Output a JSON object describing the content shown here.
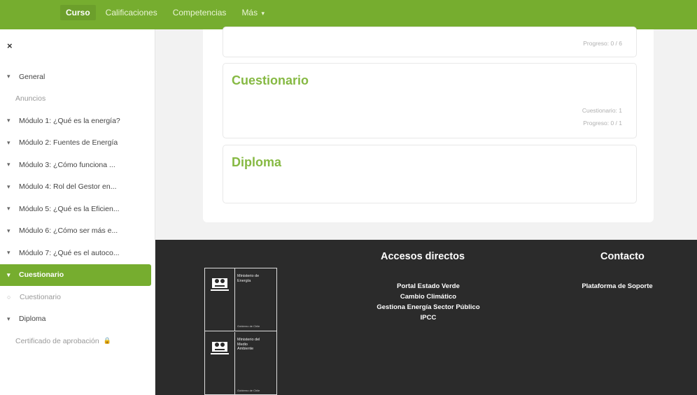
{
  "nav": {
    "items": [
      {
        "label": "Curso",
        "active": true
      },
      {
        "label": "Calificaciones",
        "active": false
      },
      {
        "label": "Competencias",
        "active": false
      },
      {
        "label": "Más",
        "active": false,
        "dropdown": true
      }
    ]
  },
  "drawer": {
    "close_icon": "×",
    "items": [
      {
        "label": "General",
        "kind": "section"
      },
      {
        "label": "Anuncios",
        "kind": "sub"
      },
      {
        "label": "Módulo 1: ¿Qué es la energía?",
        "kind": "section"
      },
      {
        "label": "Módulo 2: Fuentes de Energía",
        "kind": "section"
      },
      {
        "label": "Módulo 3: ¿Cómo funciona ...",
        "kind": "section"
      },
      {
        "label": "Módulo 4: Rol del Gestor en...",
        "kind": "section"
      },
      {
        "label": "Módulo 5: ¿Qué es la Eficien...",
        "kind": "section"
      },
      {
        "label": "Módulo 6: ¿Cómo ser más e...",
        "kind": "section"
      },
      {
        "label": "Módulo 7: ¿Qué es el autoco...",
        "kind": "section"
      },
      {
        "label": "Cuestionario",
        "kind": "section",
        "active": true
      },
      {
        "label": "Cuestionario",
        "kind": "activity"
      },
      {
        "label": "Diploma",
        "kind": "section"
      },
      {
        "label": "Certificado de aprobación",
        "kind": "locked"
      }
    ]
  },
  "sections": {
    "top": {
      "progress": "Progreso: 0 / 6"
    },
    "quiz": {
      "title": "Cuestionario",
      "count": "Cuestionario: 1",
      "progress": "Progreso: 0 / 1"
    },
    "diploma": {
      "title": "Diploma"
    }
  },
  "footer": {
    "logo1": {
      "line1": "Ministerio de",
      "line2": "Energía",
      "foot": "Gobierno de Chile"
    },
    "logo2": {
      "line1": "Ministerio del",
      "line2": "Medio",
      "line3": "Ambiente",
      "foot": "Gobierno de Chile"
    },
    "shortcuts": {
      "title": "Accesos directos",
      "links": [
        "Portal Estado Verde",
        "Cambio Climático",
        "Gestiona Energía Sector Público",
        "IPCC"
      ]
    },
    "contact": {
      "title": "Contacto",
      "links": [
        "Plataforma de Soporte"
      ]
    }
  },
  "colors": {
    "accent": "#76ad2f",
    "title_green": "#86b943",
    "footer_bg": "#2b2b2b"
  }
}
